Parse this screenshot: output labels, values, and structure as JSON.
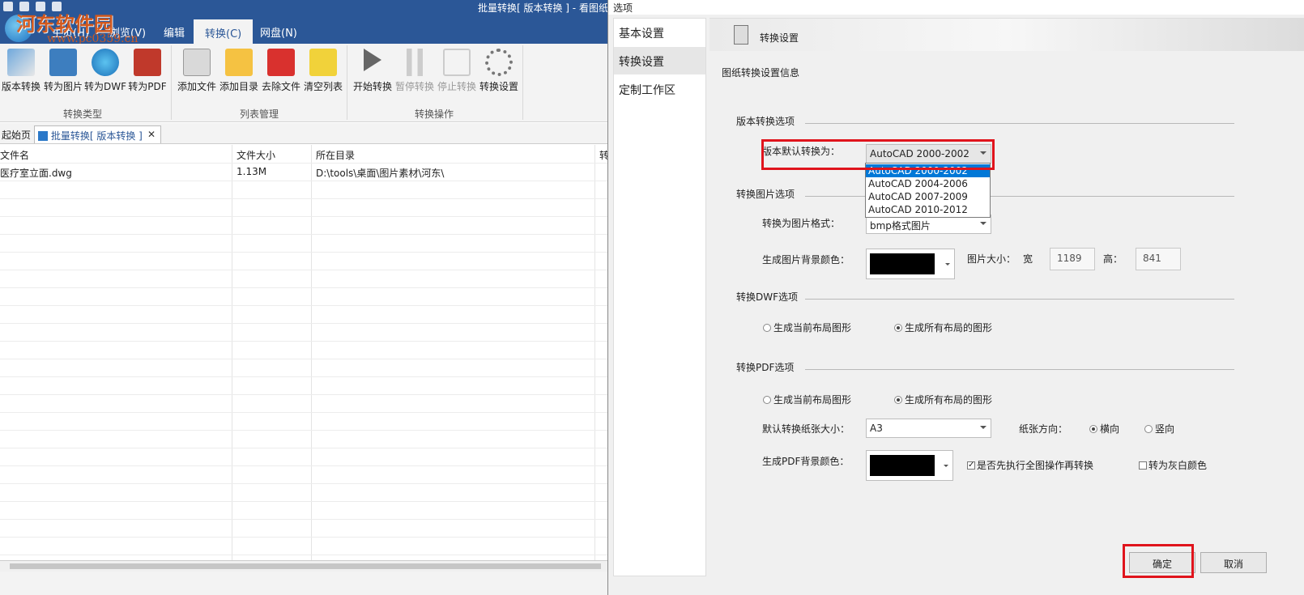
{
  "app": {
    "title": "批量转换[ 版本转换 ] - 看图纸(CA",
    "watermark": "河东软件园",
    "watermark_url": "www.pc0359.cn",
    "menu": [
      "主页(H)",
      "浏览(V)",
      "编辑",
      "转换(C)",
      "网盘(N)"
    ],
    "ribbon": {
      "group1": {
        "label": "转换类型",
        "buttons": [
          "版本转换",
          "转为图片",
          "转为DWF",
          "转为PDF"
        ]
      },
      "group2": {
        "label": "列表管理",
        "buttons": [
          "添加文件",
          "添加目录",
          "去除文件",
          "清空列表"
        ]
      },
      "group3": {
        "label": "转换操作",
        "buttons": [
          "开始转换",
          "暂停转换",
          "停止转换",
          "转换设置"
        ]
      }
    },
    "tabs": {
      "start": "起始页",
      "active": "批量转换[ 版本转换 ]",
      "close": "✕"
    },
    "table": {
      "headers": [
        "文件名",
        "文件大小",
        "所在目录",
        "转"
      ],
      "rows": [
        {
          "name": "医疗室立面.dwg",
          "size": "1.13M",
          "dir": "D:\\tools\\桌面\\图片素材\\河东\\"
        }
      ]
    }
  },
  "dialog": {
    "title": "选项",
    "nav": [
      "基本设置",
      "转换设置",
      "定制工作区"
    ],
    "header": "转换设置",
    "info": "图纸转换设置信息",
    "version": {
      "section": "版本转换选项",
      "label": "版本默认转换为：",
      "value": "AutoCAD 2000-2002",
      "options": [
        "AutoCAD 2000-2002",
        "AutoCAD 2004-2006",
        "AutoCAD 2007-2009",
        "AutoCAD 2010-2012"
      ]
    },
    "image": {
      "section": "转换图片选项",
      "format_label": "转换为图片格式：",
      "format_value": "bmp格式图片",
      "bg_label": "生成图片背景颜色：",
      "size_label": "图片大小：",
      "width_label": "宽",
      "width_value": "1189",
      "height_label": "高：",
      "height_value": "841"
    },
    "dwf": {
      "section": "转换DWF选项",
      "opt1": "生成当前布局图形",
      "opt2": "生成所有布局的图形"
    },
    "pdf": {
      "section": "转换PDF选项",
      "opt1": "生成当前布局图形",
      "opt2": "生成所有布局的图形",
      "paper_label": "默认转换纸张大小：",
      "paper_value": "A3",
      "orient_label": "纸张方向：",
      "orient_h": "横向",
      "orient_v": "竖向",
      "bg_label": "生成PDF背景颜色：",
      "check1": "是否先执行全图操作再转换",
      "check2": "转为灰白颜色"
    },
    "buttons": {
      "ok": "确定",
      "cancel": "取消"
    }
  },
  "colors": {
    "brand": "#2b5797",
    "highlight": "#e0141c",
    "select": "#0078d7"
  }
}
